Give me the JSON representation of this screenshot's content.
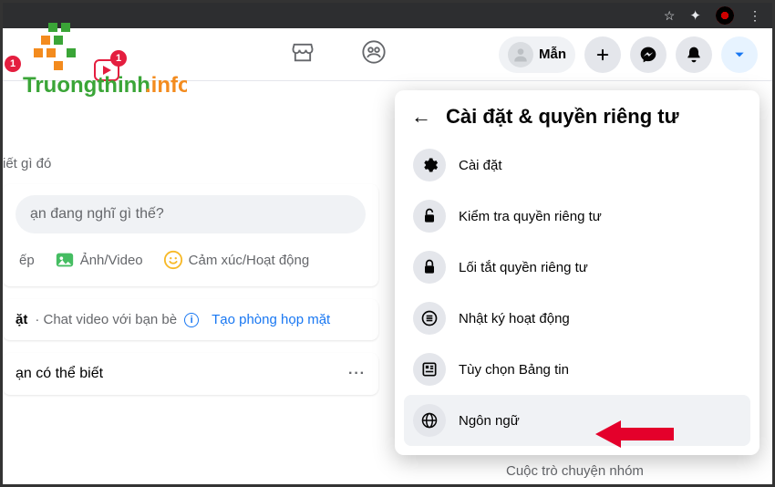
{
  "topnav": {
    "profile_name": "Mẫn",
    "badge1": "1",
    "badge2": "1"
  },
  "left": {
    "sub_text": "iết gì đó",
    "composer_placeholder": "ạn đang nghĩ gì thế?",
    "action_live": "ếp",
    "action_photo": "Ảnh/Video",
    "action_feeling": "Cảm xúc/Hoạt động",
    "room_title": "ặt",
    "room_sub": "· Chat video với bạn bè",
    "room_link": "Tạo phòng họp mặt",
    "pymk": "ạn có thể biết",
    "pymk_dots": "···"
  },
  "dropdown": {
    "title": "Cài đặt & quyền riêng tư",
    "items": [
      {
        "label": "Cài đặt"
      },
      {
        "label": "Kiểm tra quyền riêng tư"
      },
      {
        "label": "Lối tắt quyền riêng tư"
      },
      {
        "label": "Nhật ký hoạt động"
      },
      {
        "label": "Tùy chọn Bảng tin"
      },
      {
        "label": "Ngôn ngữ"
      }
    ]
  },
  "chat_label": "Cuộc trò chuyện nhóm",
  "logo": {
    "part1": "Truongthinh",
    "part2": ".info"
  }
}
